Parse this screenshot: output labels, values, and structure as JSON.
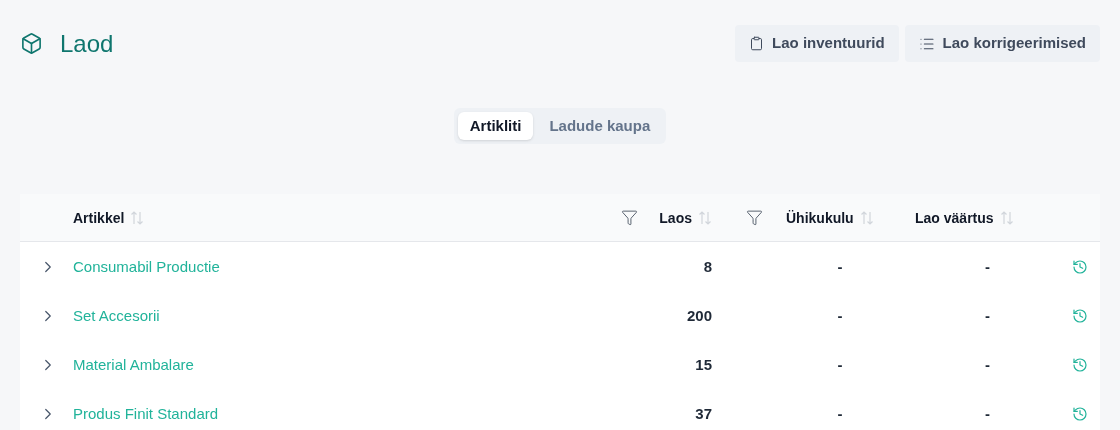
{
  "header": {
    "title": "Laod",
    "buttons": [
      {
        "kind": "clipboard",
        "label": "Lao inventuurid"
      },
      {
        "kind": "list",
        "label": "Lao korrigeerimised"
      }
    ]
  },
  "tabs": [
    {
      "label": "Artikliti",
      "selected": true
    },
    {
      "label": "Ladude kaupa",
      "selected": false
    }
  ],
  "table": {
    "columns": [
      {
        "label": "Artikkel",
        "filter": false
      },
      {
        "label": "Laos",
        "filter": true
      },
      {
        "label": "Ühikukulu",
        "filter": true
      },
      {
        "label": "Lao väärtus",
        "filter": false
      }
    ],
    "rows": [
      {
        "name": "Consumabil Productie",
        "stock": "8",
        "unit_cost": "-",
        "value": "-",
        "expanded": false
      },
      {
        "name": "Set Accesorii",
        "stock": "200",
        "unit_cost": "-",
        "value": "-",
        "expanded": false
      },
      {
        "name": "Material Ambalare",
        "stock": "15",
        "unit_cost": "-",
        "value": "-",
        "expanded": false
      },
      {
        "name": "Produs Finit Standard",
        "stock": "37",
        "unit_cost": "-",
        "value": "-",
        "expanded": false
      }
    ]
  }
}
